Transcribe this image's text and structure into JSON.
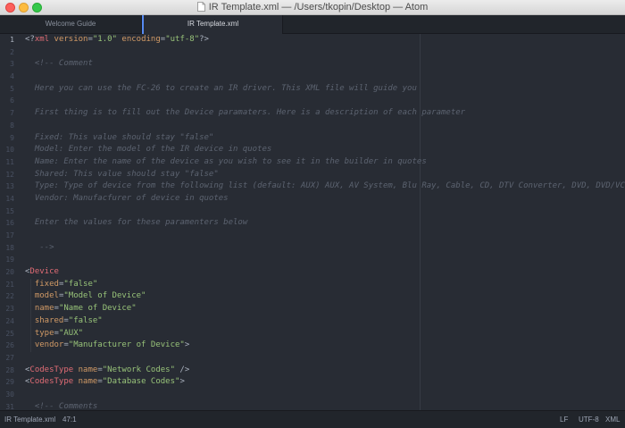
{
  "window": {
    "title": "IR Template.xml — /Users/tkopin/Desktop — Atom"
  },
  "tabs": [
    {
      "label": "Welcome Guide",
      "active": false
    },
    {
      "label": "IR Template.xml",
      "active": true
    }
  ],
  "editor": {
    "current_line": 1,
    "lines": [
      {
        "n": "1",
        "cls": "pi",
        "text": "<?xml version=\"1.0\" encoding=\"utf-8\"?>"
      },
      {
        "n": "2",
        "cls": "blank",
        "text": ""
      },
      {
        "n": "3",
        "cls": "comment",
        "text": "  <!-- Comment"
      },
      {
        "n": "4",
        "cls": "blank",
        "text": ""
      },
      {
        "n": "5",
        "cls": "comment",
        "text": "  Here you can use the FC-26 to create an IR driver. This XML file will guide you"
      },
      {
        "n": "6",
        "cls": "blank",
        "text": ""
      },
      {
        "n": "7",
        "cls": "comment",
        "text": "  First thing is to fill out the Device paramaters. Here is a description of each parameter"
      },
      {
        "n": "8",
        "cls": "blank",
        "text": ""
      },
      {
        "n": "9",
        "cls": "comment",
        "text": "  Fixed: This value should stay \"false\""
      },
      {
        "n": "10",
        "cls": "comment",
        "text": "  Model: Enter the model of the IR device in quotes"
      },
      {
        "n": "11",
        "cls": "comment",
        "text": "  Name: Enter the name of the device as you wish to see it in the builder in quotes"
      },
      {
        "n": "12",
        "cls": "comment",
        "text": "  Shared: This value should stay \"false\""
      },
      {
        "n": "13",
        "cls": "comment",
        "text": "  Type: Type of device from the following list (default: AUX) AUX, AV System, Blu Ray, Cable, CD, DTV Converter, DVD, DVD/VCR Combo"
      },
      {
        "n": "14",
        "cls": "comment",
        "text": "  Vendor: Manufacfurer of device in quotes"
      },
      {
        "n": "15",
        "cls": "blank",
        "text": ""
      },
      {
        "n": "16",
        "cls": "comment",
        "text": "  Enter the values for these paramenters below"
      },
      {
        "n": "17",
        "cls": "blank",
        "text": ""
      },
      {
        "n": "18",
        "cls": "comment",
        "text": "   -->"
      },
      {
        "n": "19",
        "cls": "blank",
        "text": ""
      },
      {
        "n": "20",
        "cls": "open",
        "tag": "Device"
      },
      {
        "n": "21",
        "cls": "attr",
        "attr": "fixed",
        "val": "\"false\""
      },
      {
        "n": "22",
        "cls": "attr",
        "attr": "model",
        "val": "\"Model of Device\""
      },
      {
        "n": "23",
        "cls": "attr",
        "attr": "name",
        "val": "\"Name of Device\""
      },
      {
        "n": "24",
        "cls": "attr",
        "attr": "shared",
        "val": "\"false\""
      },
      {
        "n": "25",
        "cls": "attr",
        "attr": "type",
        "val": "\"AUX\""
      },
      {
        "n": "26",
        "cls": "attrend",
        "attr": "vendor",
        "val": "\"Manufacturer of Device\""
      },
      {
        "n": "27",
        "cls": "blank",
        "text": ""
      },
      {
        "n": "28",
        "cls": "selfclose",
        "tag": "CodesType",
        "attr": "name",
        "val": "\"Network Codes\""
      },
      {
        "n": "29",
        "cls": "openattr",
        "tag": "CodesType",
        "attr": "name",
        "val": "\"Database Codes\""
      },
      {
        "n": "30",
        "cls": "blank",
        "text": ""
      },
      {
        "n": "31",
        "cls": "comment",
        "text": "  <!-- Comments"
      }
    ]
  },
  "status": {
    "file": "IR Template.xml",
    "cursor": "47:1",
    "line_ending": "LF",
    "encoding": "UTF-8",
    "grammar": "XML"
  },
  "colors": {
    "comment": "#5c6370",
    "tag": "#e06c75",
    "attribute": "#d19a66",
    "string": "#98c379",
    "accent": "#568af2"
  }
}
